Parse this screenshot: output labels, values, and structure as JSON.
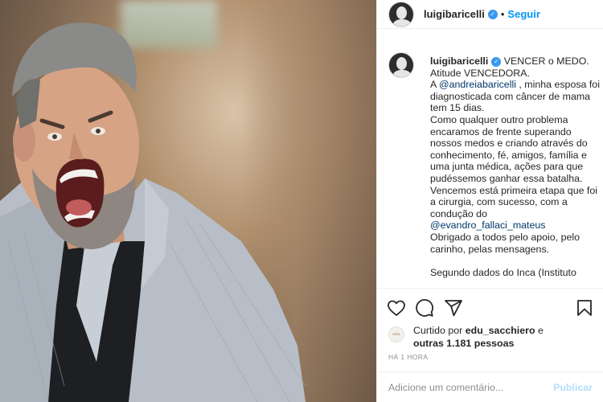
{
  "post": {
    "image_alt": "Homem de barba grisalha e blazer xadrez gritando com expressão de vitória"
  },
  "header": {
    "username": "luigibaricelli",
    "verified_icon": "verified-badge-icon",
    "separator": "•",
    "follow_label": "Seguir"
  },
  "caption": {
    "username": "luigibaricelli",
    "line1": "VENCER o MEDO.",
    "line2": "Atitude VENCEDORA.",
    "line3_prefix": "A ",
    "mention1": "@andreiabaricelli",
    "line3_suffix": " , minha esposa foi",
    "line4": "diagnosticada com câncer de mama",
    "line5": "tem 15 dias.",
    "line6": "Como qualquer outro problema",
    "line7": "encaramos de frente superando",
    "line8": "nossos medos e criando através do",
    "line9": "conhecimento, fé, amigos, família e",
    "line10": "uma junta médica, ações para que",
    "line11": "pudéssemos ganhar essa batalha.",
    "line12": "Vencemos está primeira etapa que foi",
    "line13": "a cirurgia, com sucesso, com a",
    "line14": "condução do",
    "mention2": "@evandro_fallaci_mateus",
    "line15": "Obrigado a todos pelo apoio, pelo",
    "line16": "carinho, pelas mensagens.",
    "line17": "Segundo dados do Inca (Instituto"
  },
  "actions": {
    "like_icon": "heart-icon",
    "comment_icon": "comment-icon",
    "share_icon": "share-icon",
    "save_icon": "bookmark-icon"
  },
  "likes": {
    "avatar_text": "edu",
    "prefix": "Curtido por ",
    "user": "edu_sacchiero",
    "middle": " e",
    "others": "outras 1.181 pessoas"
  },
  "timestamp": "HÁ 1 HORA",
  "comment_box": {
    "placeholder": "Adicione um comentário...",
    "publish_label": "Publicar"
  },
  "colors": {
    "accent": "#0095f6",
    "verified": "#3897f0",
    "mention": "#00376b",
    "publish_disabled": "#b2dffc",
    "muted": "#8e8e8e"
  }
}
